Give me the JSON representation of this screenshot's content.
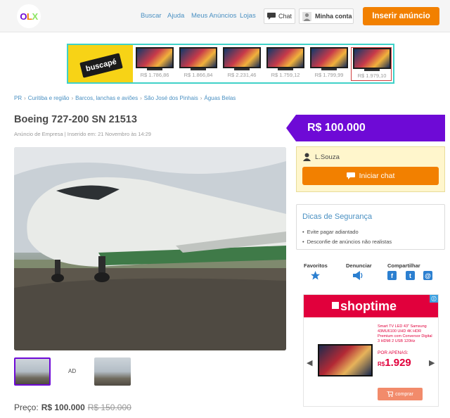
{
  "header": {
    "logo": {
      "o": "O",
      "l": "L",
      "x": "X"
    },
    "nav": [
      "Buscar",
      "Ajuda",
      "Meus Anúncios",
      "Lojas"
    ],
    "chat_label": "Chat",
    "account_label": "Minha conta",
    "insert_label": "Inserir anúncio"
  },
  "banner": {
    "brand": "buscapé",
    "tv_prices": [
      "R$ 1.786,86",
      "R$ 1.866,84",
      "R$ 2.231,46",
      "R$ 1.759,12",
      "R$ 1.799,99",
      "R$ 1.979,10"
    ]
  },
  "breadcrumb": [
    "PR",
    "Curitiba e região",
    "Barcos, lanchas e aviões",
    "São José dos Pinhais",
    "Águas Belas"
  ],
  "listing": {
    "title": "Boeing 727-200 SN 21513",
    "subtitle": "Anúncio de Empresa | Inserido em: 21 Novembro às 14:29",
    "price": "R$ 100.000",
    "thumb_ad": "AD",
    "footer_price_label": "Preço:",
    "footer_price": "R$ 100.000",
    "footer_old_price": "R$ 150.000"
  },
  "seller": {
    "name": "L.Souza",
    "chat_button": "Iniciar chat"
  },
  "tips": {
    "title": "Dicas de Segurança",
    "items": [
      "Evite pagar adiantado",
      "Desconfie de anúncios não realistas"
    ]
  },
  "actions": {
    "favorites": "Favoritos",
    "report": "Denunciar",
    "share": "Compartilhar"
  },
  "sidebar_ad": {
    "brand": "shoptime",
    "product": "Smart TV LED 43\" Samsung 43MU6100 UHD 4K HDR Premium com Conversor Digital 3 HDMI 2 USB 120Hz",
    "offer_label": "POR APENAS:",
    "currency": "R$",
    "price": "1.929",
    "buy_button": "comprar"
  },
  "colors": {
    "purple": "#6e0ad6",
    "orange": "#f28000",
    "link_blue": "#4a90c2",
    "shoptime_red": "#e1003c"
  }
}
